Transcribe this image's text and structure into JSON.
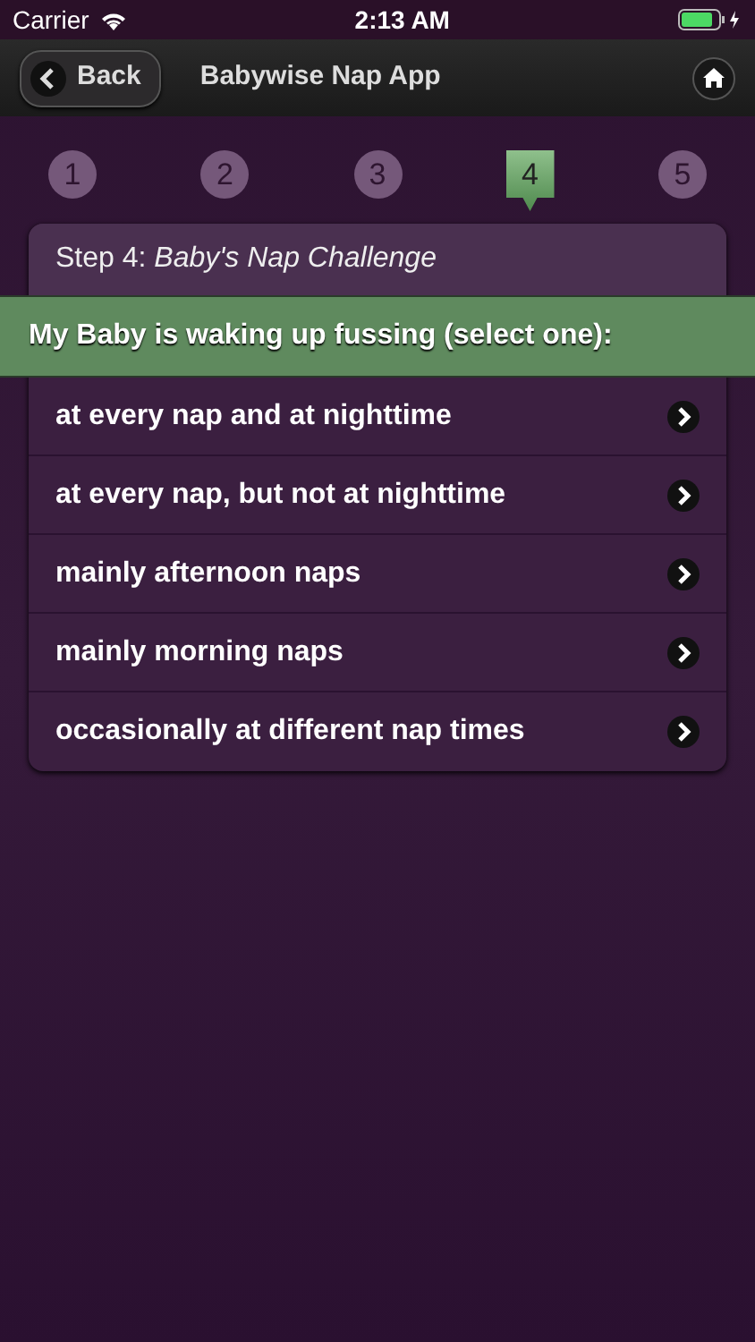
{
  "status_bar": {
    "carrier": "Carrier",
    "time": "2:13 AM"
  },
  "nav_bar": {
    "back": "Back",
    "title": "Babywise Nap App"
  },
  "steps": [
    {
      "label": "1",
      "selected": false
    },
    {
      "label": "2",
      "selected": false
    },
    {
      "label": "3",
      "selected": false
    },
    {
      "label": "4",
      "selected": true
    },
    {
      "label": "5",
      "selected": false
    }
  ],
  "card": {
    "heading": "Step 4: *Baby's Nap Challenge*",
    "prompt": "My Baby is waking up fussing (select one):",
    "options": [
      "at every nap and at nighttime",
      "at every nap, but not at nighttime",
      "mainly afternoon naps",
      "mainly morning naps",
      "occasionally at different nap times"
    ]
  }
}
